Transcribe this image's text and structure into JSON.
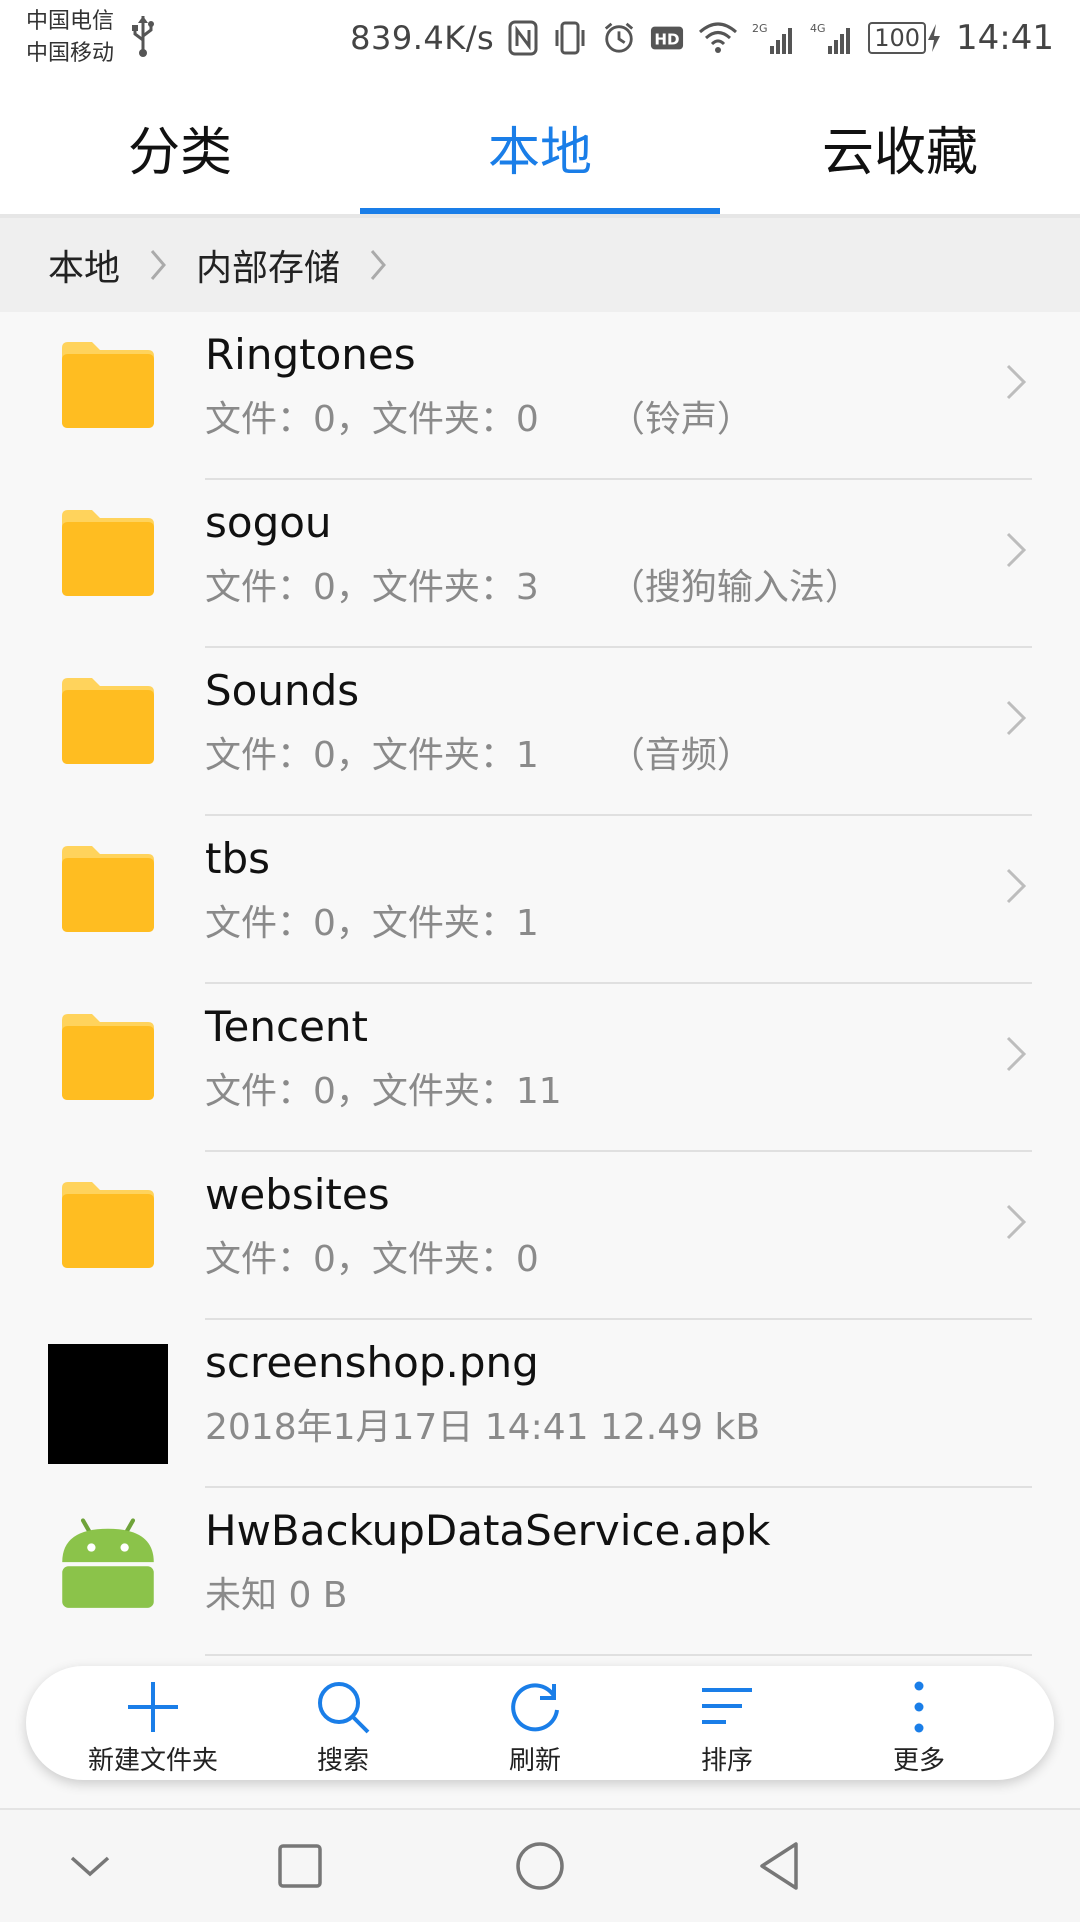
{
  "status_bar": {
    "carrier_1": "中国电信",
    "carrier_2": "中国移动",
    "speed": "839.4K/s",
    "battery": "100",
    "time": "14:41"
  },
  "tabs": [
    {
      "label": "分类",
      "active": false
    },
    {
      "label": "本地",
      "active": true
    },
    {
      "label": "云收藏",
      "active": false
    }
  ],
  "breadcrumb": [
    "本地",
    "内部存储"
  ],
  "items": [
    {
      "name": "Ringtones",
      "meta": "文件：0，文件夹：0",
      "desc": "（铃声）",
      "type": "folder"
    },
    {
      "name": "sogou",
      "meta": "文件：0，文件夹：3",
      "desc": "（搜狗输入法）",
      "type": "folder"
    },
    {
      "name": "Sounds",
      "meta": "文件：0，文件夹：1",
      "desc": "（音频）",
      "type": "folder"
    },
    {
      "name": "tbs",
      "meta": "文件：0，文件夹：1",
      "desc": "",
      "type": "folder"
    },
    {
      "name": "Tencent",
      "meta": "文件：0，文件夹：11",
      "desc": "",
      "type": "folder"
    },
    {
      "name": "websites",
      "meta": "文件：0，文件夹：0",
      "desc": "",
      "type": "folder"
    },
    {
      "name": "screenshop.png",
      "meta": "2018年1月17日 14:41 12.49 kB",
      "desc": "",
      "type": "image"
    },
    {
      "name": "HwBackupDataService.apk",
      "meta": "未知  0 B",
      "desc": "",
      "type": "apk"
    }
  ],
  "actions": [
    {
      "label": "新建文件夹",
      "icon": "plus-icon"
    },
    {
      "label": "搜索",
      "icon": "search-icon"
    },
    {
      "label": "刷新",
      "icon": "refresh-icon"
    },
    {
      "label": "排序",
      "icon": "sort-icon"
    },
    {
      "label": "更多",
      "icon": "more-icon"
    }
  ],
  "colors": {
    "accent": "#1a7ee8",
    "folder": "#ffbd21",
    "android": "#8bc34a"
  }
}
